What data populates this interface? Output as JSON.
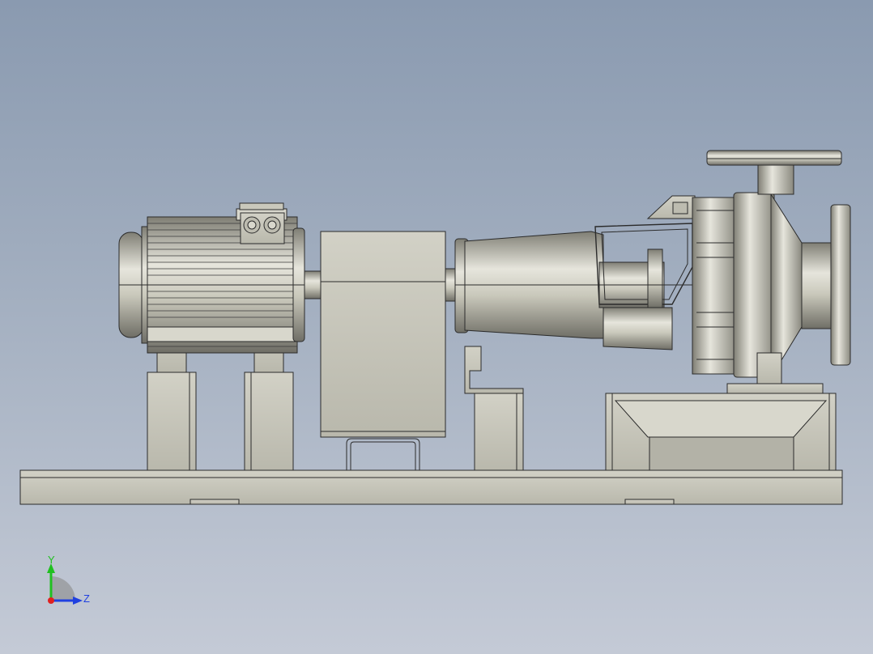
{
  "viewport": {
    "background_top": "#8a9ab0",
    "background_bottom": "#c4cad6"
  },
  "model": {
    "colors": {
      "body": "#c9c8bb",
      "body_light": "#e6e5dc",
      "body_dark": "#7f7e74",
      "edge": "#2b2b2b"
    }
  },
  "triad": {
    "y_label": "Y",
    "z_label": "Z",
    "colors": {
      "y": "#20c020",
      "z": "#2040e0",
      "x": "#e02020"
    }
  }
}
